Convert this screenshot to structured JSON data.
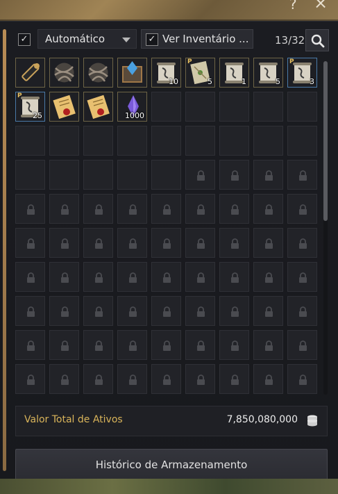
{
  "window": {
    "help_glyph": "?",
    "close_glyph": "×"
  },
  "toolbar": {
    "sort_checkbox_checked": true,
    "sort_mode": "Automático",
    "inventory_checkbox_checked": true,
    "inventory_label": "Ver Inventário ...",
    "slot_count": "13/32",
    "search_icon": "search-icon"
  },
  "items": [
    {
      "name": "spyglass-item-icon",
      "qty": "",
      "premium": false,
      "color": "#c9a25a"
    },
    {
      "name": "wrapped-ore-item-icon",
      "qty": "",
      "premium": false,
      "color": "#9a8e80"
    },
    {
      "name": "wrapped-ore-item-icon",
      "qty": "",
      "premium": false,
      "color": "#9a8e80"
    },
    {
      "name": "blue-crystal-box-item-icon",
      "qty": "",
      "premium": false,
      "color": "#4aa0e0"
    },
    {
      "name": "scroll-item-icon",
      "qty": "10",
      "premium": false,
      "color": "#d8d2c4"
    },
    {
      "name": "map-scroll-item-icon",
      "qty": "5",
      "premium": true,
      "color": "#d0c8a8"
    },
    {
      "name": "scroll-item-icon",
      "qty": "1",
      "premium": false,
      "color": "#d8d2c4"
    },
    {
      "name": "scroll-item-icon",
      "qty": "5",
      "premium": false,
      "color": "#d8d2c4"
    },
    {
      "name": "scroll-item-icon",
      "qty": "3",
      "premium": true,
      "color": "#d8d2c4"
    },
    {
      "name": "scroll-item-icon",
      "qty": "25",
      "premium": true,
      "color": "#d8d2c4"
    },
    {
      "name": "sealed-letter-item-icon",
      "qty": "",
      "premium": false,
      "color": "#e8c070"
    },
    {
      "name": "sealed-letter-item-icon",
      "qty": "",
      "premium": false,
      "color": "#e8c070"
    },
    {
      "name": "purple-crystal-item-icon",
      "qty": "1000",
      "premium": false,
      "color": "#7a5ad8"
    }
  ],
  "grid": {
    "columns": 9,
    "unlocked_slots": 32,
    "visible_rows": 10
  },
  "assets": {
    "label": "Valor Total de Ativos",
    "value": "7,850,080,000",
    "icon": "silver-coins-icon"
  },
  "history_button": {
    "label": "Histórico de Armazenamento"
  },
  "colors": {
    "accent_gold": "#d9b45a",
    "panel_bg": "#1b1c21",
    "slot_bg": "#222328"
  }
}
